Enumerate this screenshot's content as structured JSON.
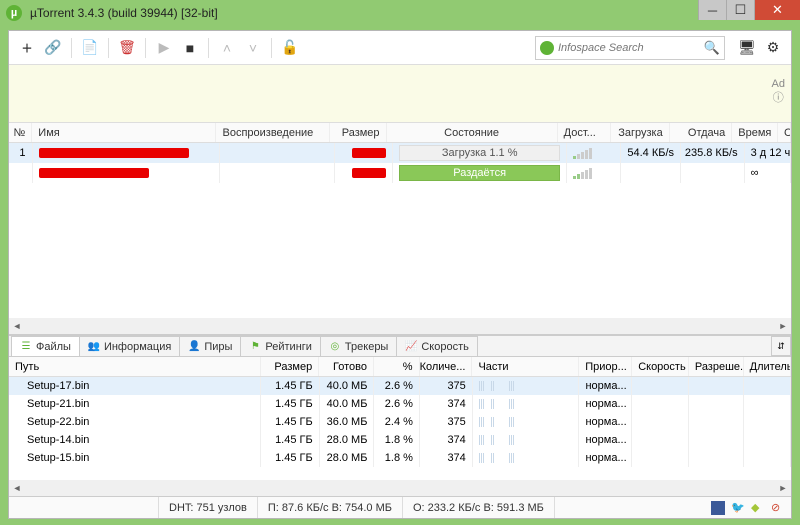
{
  "window": {
    "title": "µTorrent 3.4.3  (build 39944) [32-bit]"
  },
  "search": {
    "placeholder": "Infospace Search"
  },
  "ad": {
    "label": "Ad"
  },
  "torrents": {
    "headers": {
      "num": "№",
      "name": "Имя",
      "play": "Воспроизведение",
      "size": "Размер",
      "state": "Состояние",
      "avail": "Дост...",
      "dl": "Загрузка",
      "ul": "Отдача",
      "time": "Время",
      "rest": "С"
    },
    "rows": [
      {
        "num": "1",
        "state": "Загрузка 1.1 %",
        "dl": "54.4 КБ/s",
        "ul": "235.8 КБ/s",
        "time": "3 д 12 ч"
      },
      {
        "num": "",
        "state": "Раздаётся",
        "dl": "",
        "ul": "",
        "time": "∞"
      }
    ]
  },
  "tabs": {
    "files": "Файлы",
    "info": "Информация",
    "peers": "Пиры",
    "ratings": "Рейтинги",
    "trackers": "Трекеры",
    "speed": "Скорость"
  },
  "files": {
    "headers": {
      "path": "Путь",
      "size": "Размер",
      "done": "Готово",
      "pct": "%",
      "cnt": "Количе...",
      "parts": "Части",
      "prio": "Приор...",
      "speed": "Скорость",
      "perm": "Разреше...",
      "dur": "Длитель..."
    },
    "rows": [
      {
        "path": "Setup-17.bin",
        "size": "1.45 ГБ",
        "done": "40.0 МБ",
        "pct": "2.6 %",
        "cnt": "375",
        "prio": "норма..."
      },
      {
        "path": "Setup-21.bin",
        "size": "1.45 ГБ",
        "done": "40.0 МБ",
        "pct": "2.6 %",
        "cnt": "374",
        "prio": "норма..."
      },
      {
        "path": "Setup-22.bin",
        "size": "1.45 ГБ",
        "done": "36.0 МБ",
        "pct": "2.4 %",
        "cnt": "375",
        "prio": "норма..."
      },
      {
        "path": "Setup-14.bin",
        "size": "1.45 ГБ",
        "done": "28.0 МБ",
        "pct": "1.8 %",
        "cnt": "374",
        "prio": "норма..."
      },
      {
        "path": "Setup-15.bin",
        "size": "1.45 ГБ",
        "done": "28.0 МБ",
        "pct": "1.8 %",
        "cnt": "374",
        "prio": "норма..."
      }
    ]
  },
  "status": {
    "dht": "DHT: 751 узлов",
    "down": "П: 87.6 КБ/с В: 754.0 МБ",
    "up": "О: 233.2 КБ/с В: 591.3 МБ"
  }
}
